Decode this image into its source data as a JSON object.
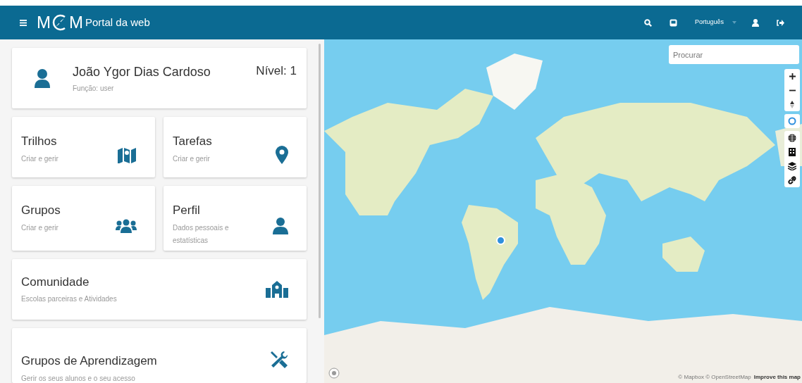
{
  "header": {
    "logo": {
      "left": "M",
      "right": "M"
    },
    "title": "Portal da web",
    "language": "Português"
  },
  "user_card": {
    "name": "João Ygor Dias Cardoso",
    "role": "Função: user",
    "level": "Nível: 1"
  },
  "tiles": [
    {
      "title": "Trilhos",
      "subtitle": "Criar e gerir"
    },
    {
      "title": "Tarefas",
      "subtitle": "Criar e gerir"
    },
    {
      "title": "Grupos",
      "subtitle": "Criar e gerir"
    },
    {
      "title": "Perfil",
      "subtitle": "Dados pessoais e estatísticas"
    }
  ],
  "wide_cards": [
    {
      "title": "Comunidade",
      "subtitle": "Escolas parceiras e Atividades"
    },
    {
      "title": "Grupos de Aprendizagem",
      "subtitle": "Gerir os seus alunos e o seu acesso"
    }
  ],
  "map": {
    "search": {
      "placeholder": "Procurar"
    },
    "attribution": "© Mapbox © OpenStreetMap",
    "improve_link": "Improve this map"
  }
}
